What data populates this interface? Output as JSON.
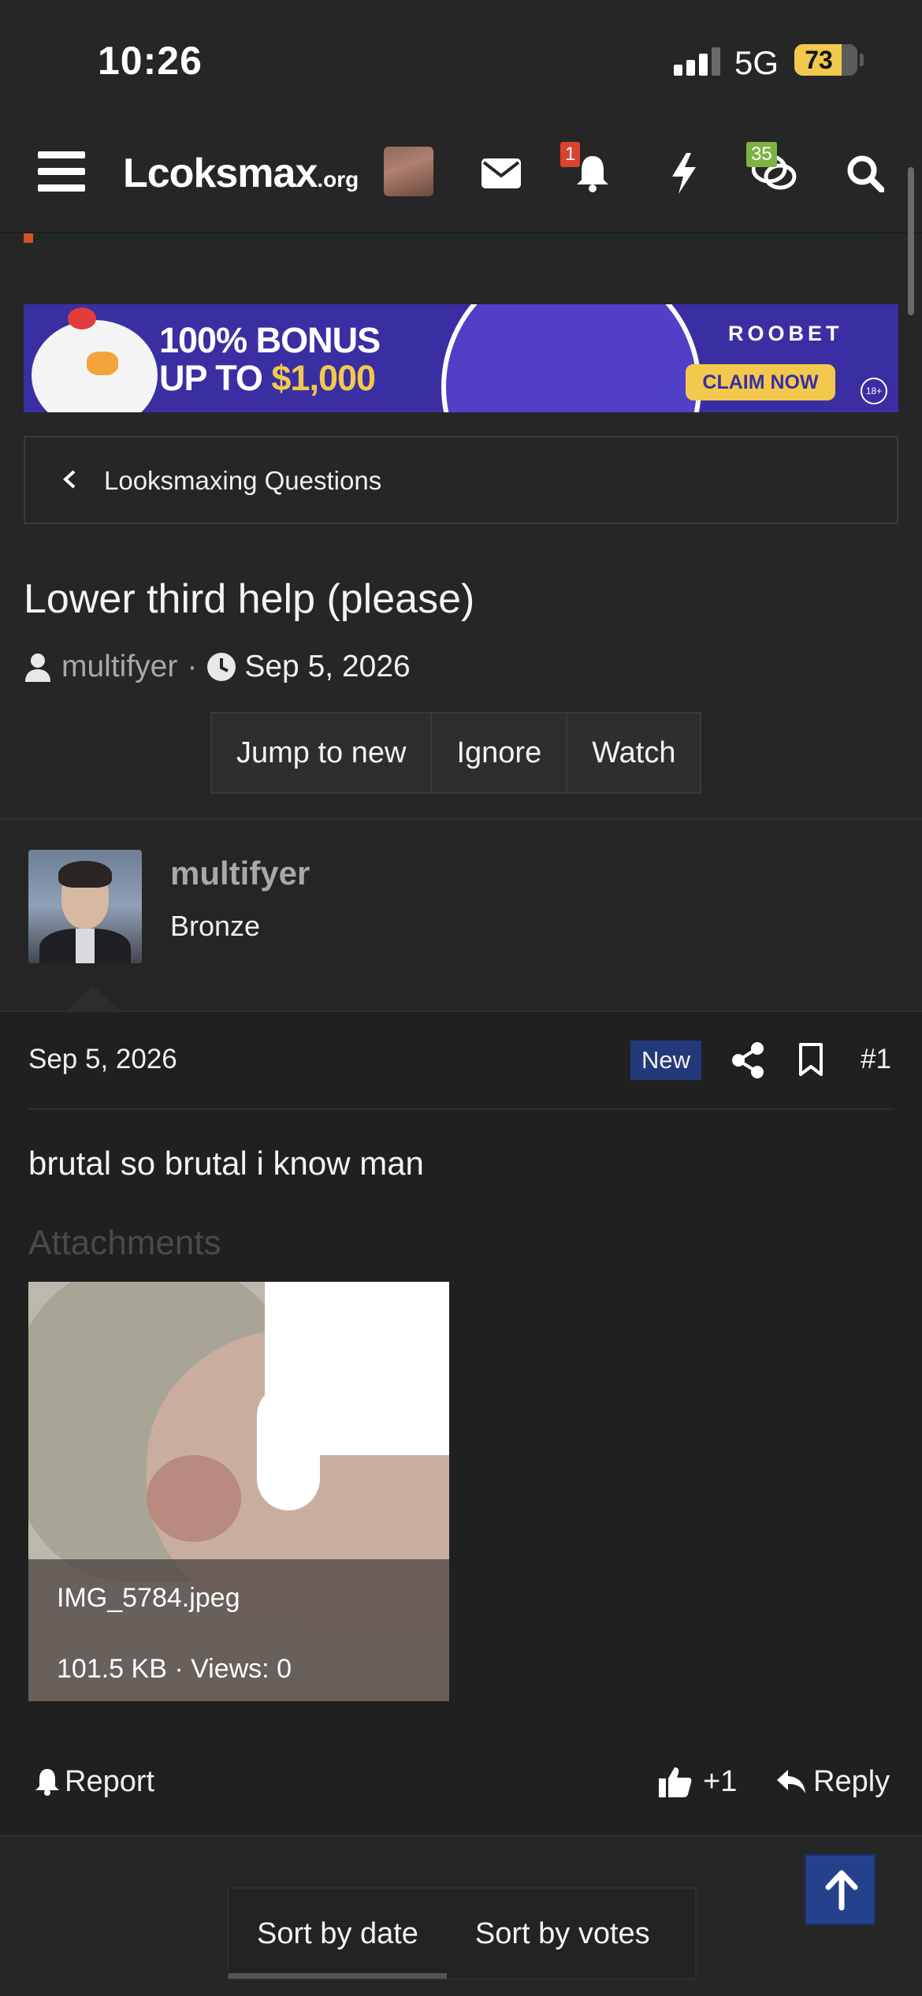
{
  "status": {
    "time": "10:26",
    "network": "5G",
    "battery": "73",
    "battery_level": 0.73
  },
  "nav": {
    "logo": "Lcoksmax",
    "logo_suffix": ".org",
    "notifications_badge": "1",
    "conversations_badge": "35",
    "icons": [
      "menu-icon",
      "avatar",
      "mail-icon",
      "bell-icon",
      "bolt-icon",
      "comments-icon",
      "search-icon"
    ]
  },
  "banner": {
    "line1": "100% BONUS",
    "line2_prefix": "UP TO ",
    "line2_amount": "$1,000",
    "brand": "ROOBET",
    "cta": "CLAIM NOW",
    "age": "18+"
  },
  "breadcrumb": {
    "label": "Looksmaxing Questions"
  },
  "thread": {
    "title": "Lower third help (please)",
    "author": "multifyer",
    "separator": "·",
    "date": "Sep 5, 2026",
    "buttons": {
      "jump": "Jump to new",
      "ignore": "Ignore",
      "watch": "Watch"
    }
  },
  "post": {
    "username": "multifyer",
    "user_title": "Bronze",
    "date": "Sep 5, 2026",
    "new_badge": "New",
    "number": "#1",
    "body": "brutal so brutal i know man",
    "attachments_label": "Attachments",
    "attachment": {
      "filename": "IMG_5784.jpeg",
      "info": "101.5 KB · Views: 0"
    },
    "actions": {
      "report": "Report",
      "likes": "+1",
      "reply": "Reply"
    }
  },
  "sort": {
    "by_date": "Sort by date",
    "by_votes": "Sort by votes"
  },
  "colors": {
    "background": "#262626",
    "post_bg": "#202020",
    "new_badge": "#23397a",
    "notif_badge": "#d9432f",
    "convo_badge": "#7cb342",
    "to_top": "#26418c"
  }
}
